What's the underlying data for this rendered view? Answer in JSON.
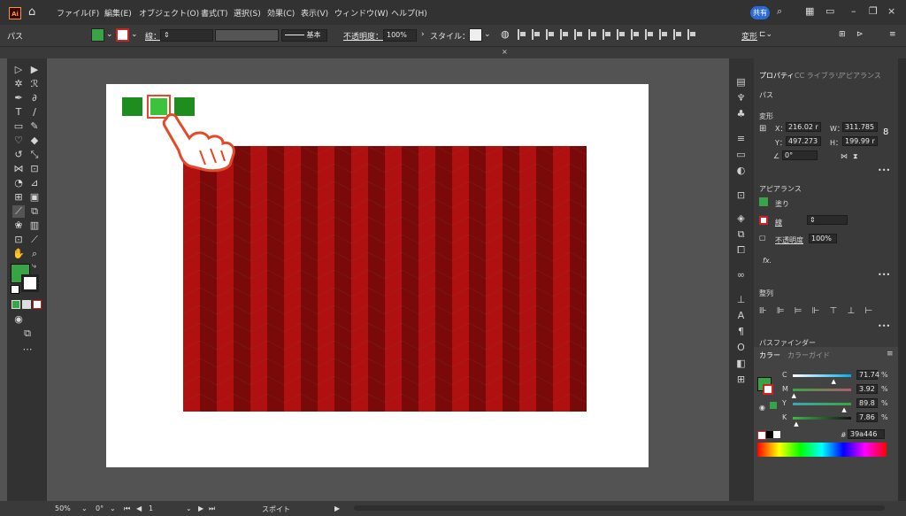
{
  "menu": {
    "logo": "Ai",
    "items": [
      "ファイル(F)",
      "編集(E)",
      "オブジェクト(O)",
      "書式(T)",
      "選択(S)",
      "効果(C)",
      "表示(V)",
      "ウィンドウ(W)",
      "ヘルプ(H)"
    ],
    "share_label": "共有"
  },
  "control_bar": {
    "object_type": "パス",
    "stroke_label": "線：",
    "stroke_style": "基本",
    "opacity_label": "不透明度：",
    "opacity_value": "100%",
    "style_label": "スタイル：",
    "transform_label": "変形"
  },
  "tab": {
    "close": "×"
  },
  "swatches": {
    "top_colors": [
      "#1e8c1e",
      "#3bc43b",
      "#1e8c1e"
    ]
  },
  "colors": {
    "pattern_red": "#b01010",
    "pattern_dark_red": "#7a0a0a",
    "pattern_green": "#39a446",
    "highlight": "#e34a2a"
  },
  "panel": {
    "tabs": [
      "プロパティ",
      "CC ライブラリ",
      "アピアランス"
    ],
    "object_type": "パス",
    "transform_title": "変形",
    "x_label": "X：",
    "x_value": "216.02 r",
    "y_label": "Y：",
    "y_value": "497.273",
    "w_label": "W：",
    "w_value": "311.785",
    "h_label": "H：",
    "h_value": "199.99 r",
    "angle_value": "0°",
    "appearance_title": "アピアランス",
    "fill_label": "塗り",
    "stroke_label": "線",
    "opacity_label": "不透明度",
    "opacity_value": "100%",
    "fx_label": "fx.",
    "align_title": "整列",
    "pathfinder_title": "パスファインダー",
    "more": "•••"
  },
  "color_panel": {
    "tabs": [
      "カラー",
      "カラーガイド"
    ],
    "c_label": "C",
    "c_value": "71.74",
    "c_level": 0.72,
    "m_label": "M",
    "m_value": "3.92",
    "m_level": 0.04,
    "y_label": "Y",
    "y_value": "89.8",
    "y_level": 0.9,
    "k_label": "K",
    "k_value": "7.86",
    "k_level": 0.08,
    "percent": "%",
    "hex_prefix": "#",
    "hex_value": "39a446"
  },
  "status_bar": {
    "zoom": "50%",
    "rotation": "0°",
    "artboard_number": "1",
    "tool_name": "スポイト"
  }
}
